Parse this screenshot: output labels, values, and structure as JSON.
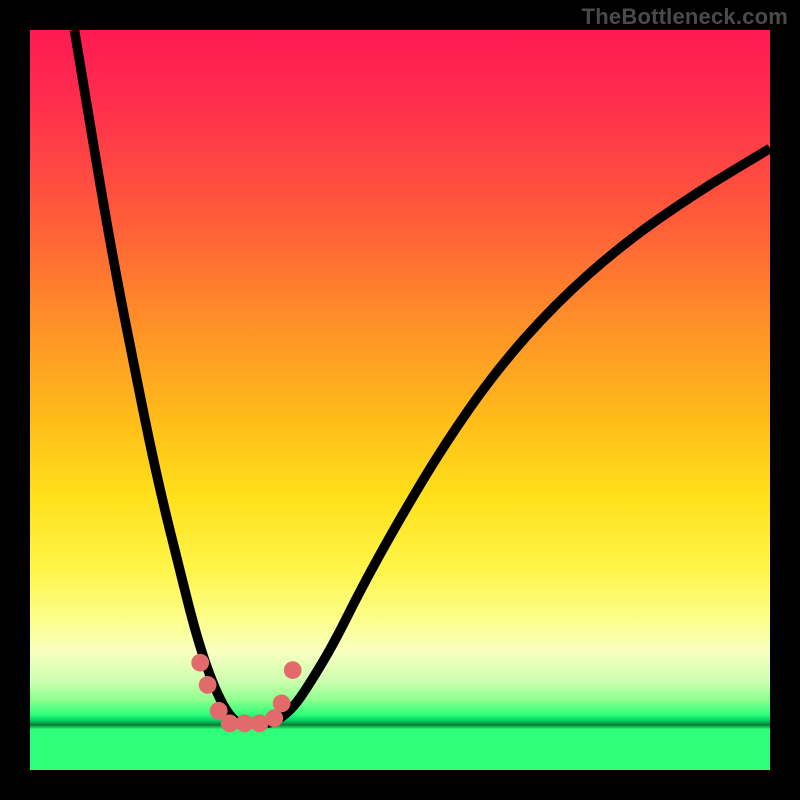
{
  "watermark": "TheBottleneck.com",
  "chart_data": {
    "type": "line",
    "title": "",
    "xlabel": "",
    "ylabel": "",
    "xlim": [
      0,
      100
    ],
    "ylim": [
      0,
      100
    ],
    "series": [
      {
        "name": "left-curve",
        "x": [
          6,
          8,
          10,
          12,
          14,
          16,
          18,
          20,
          22,
          23.5,
          25,
          26.5,
          28,
          29
        ],
        "y": [
          100,
          88,
          76,
          65,
          55,
          45,
          36,
          28,
          20,
          15,
          11,
          8,
          6.3,
          6.3
        ]
      },
      {
        "name": "right-curve",
        "x": [
          32,
          33,
          34.5,
          36,
          38,
          41,
          45,
          50,
          56,
          63,
          71,
          80,
          90,
          100
        ],
        "y": [
          6.3,
          6.5,
          7.5,
          9,
          12,
          17,
          25,
          34,
          44,
          54,
          63,
          71,
          78,
          84
        ]
      }
    ],
    "markers": [
      {
        "name": "m1",
        "x": 23.0,
        "y": 14.5
      },
      {
        "name": "m2",
        "x": 24.0,
        "y": 11.5
      },
      {
        "name": "m3",
        "x": 25.5,
        "y": 8.0
      },
      {
        "name": "m4",
        "x": 27.0,
        "y": 6.3
      },
      {
        "name": "m5",
        "x": 29.0,
        "y": 6.3
      },
      {
        "name": "m6",
        "x": 31.0,
        "y": 6.3
      },
      {
        "name": "m7",
        "x": 33.0,
        "y": 7.0
      },
      {
        "name": "m8",
        "x": 34.0,
        "y": 9.0
      },
      {
        "name": "m9",
        "x": 35.5,
        "y": 13.5
      }
    ],
    "marker_radius": 1.2,
    "background_gradient": [
      {
        "stop": 0,
        "color": "#ff1a52"
      },
      {
        "stop": 0.52,
        "color": "#ffba1a"
      },
      {
        "stop": 0.8,
        "color": "#fcff8e"
      },
      {
        "stop": 0.925,
        "color": "#2fff79"
      },
      {
        "stop": 0.939,
        "color": "#0b7a37"
      },
      {
        "stop": 1.0,
        "color": "#2fff79"
      }
    ]
  }
}
